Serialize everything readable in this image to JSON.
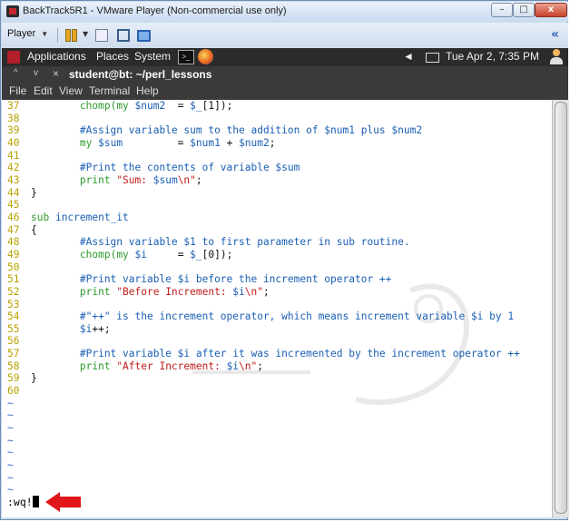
{
  "window": {
    "title": "BackTrack5R1 - VMware Player (Non-commercial use only)",
    "min": "–",
    "max": "□",
    "close": "x"
  },
  "vm_toolbar": {
    "player_label": "Player",
    "caret": "▼",
    "collapse": "«"
  },
  "gnome_panel": {
    "applications": "Applications",
    "places": "Places",
    "system": "System",
    "terminal_icon": ">_",
    "clock": "Tue Apr  2,  7:35 PM"
  },
  "terminal": {
    "title": "student@bt: ~/perl_lessons",
    "up": "^",
    "down": "v",
    "close": "×",
    "menu": [
      "File",
      "Edit",
      "View",
      "Terminal",
      "Help"
    ]
  },
  "editor": {
    "lines": [
      {
        "n": "37",
        "segs": [
          [
            "plain",
            "        "
          ],
          [
            "kw",
            "chomp("
          ],
          [
            "kw",
            "my "
          ],
          [
            "var",
            "$num2"
          ],
          [
            "plain",
            "  = "
          ],
          [
            "var",
            "$_"
          ],
          [
            "plain",
            "[1]);"
          ]
        ]
      },
      {
        "n": "38",
        "segs": []
      },
      {
        "n": "39",
        "segs": [
          [
            "cmt",
            "        #Assign variable sum to the addition of $num1 plus $num2"
          ]
        ]
      },
      {
        "n": "40",
        "segs": [
          [
            "plain",
            "        "
          ],
          [
            "kw",
            "my "
          ],
          [
            "var",
            "$sum"
          ],
          [
            "plain",
            "         = "
          ],
          [
            "var",
            "$num1"
          ],
          [
            "plain",
            " + "
          ],
          [
            "var",
            "$num2"
          ],
          [
            "plain",
            ";"
          ]
        ]
      },
      {
        "n": "41",
        "segs": []
      },
      {
        "n": "42",
        "segs": [
          [
            "cmt",
            "        #Print the contents of variable $sum"
          ]
        ]
      },
      {
        "n": "43",
        "segs": [
          [
            "plain",
            "        "
          ],
          [
            "kw",
            "print "
          ],
          [
            "str",
            "\"Sum: "
          ],
          [
            "var",
            "$sum"
          ],
          [
            "str",
            "\\n\""
          ],
          [
            "plain",
            ";"
          ]
        ]
      },
      {
        "n": "44",
        "segs": [
          [
            "plain",
            "}"
          ]
        ]
      },
      {
        "n": "45",
        "segs": []
      },
      {
        "n": "46",
        "segs": [
          [
            "kw",
            "sub "
          ],
          [
            "var",
            "increment_it"
          ]
        ]
      },
      {
        "n": "47",
        "segs": [
          [
            "plain",
            "{"
          ]
        ]
      },
      {
        "n": "48",
        "segs": [
          [
            "cmt",
            "        #Assign variable $1 to first parameter in sub routine."
          ]
        ]
      },
      {
        "n": "49",
        "segs": [
          [
            "plain",
            "        "
          ],
          [
            "kw",
            "chomp("
          ],
          [
            "kw",
            "my "
          ],
          [
            "var",
            "$i"
          ],
          [
            "plain",
            "     = "
          ],
          [
            "var",
            "$_"
          ],
          [
            "plain",
            "[0]);"
          ]
        ]
      },
      {
        "n": "50",
        "segs": []
      },
      {
        "n": "51",
        "segs": [
          [
            "cmt",
            "        #Print variable $i before the increment operator ++"
          ]
        ]
      },
      {
        "n": "52",
        "segs": [
          [
            "plain",
            "        "
          ],
          [
            "kw",
            "print "
          ],
          [
            "str",
            "\"Before Increment: "
          ],
          [
            "var",
            "$i"
          ],
          [
            "str",
            "\\n\""
          ],
          [
            "plain",
            ";"
          ]
        ]
      },
      {
        "n": "53",
        "segs": []
      },
      {
        "n": "54",
        "segs": [
          [
            "cmt",
            "        #\"++\" is the increment operator, which means increment variable $i by 1"
          ]
        ]
      },
      {
        "n": "55",
        "segs": [
          [
            "plain",
            "        "
          ],
          [
            "var",
            "$i"
          ],
          [
            "plain",
            "++;"
          ]
        ]
      },
      {
        "n": "56",
        "segs": []
      },
      {
        "n": "57",
        "segs": [
          [
            "cmt",
            "        #Print variable $i after it was incremented by the increment operator ++"
          ]
        ]
      },
      {
        "n": "58",
        "segs": [
          [
            "plain",
            "        "
          ],
          [
            "kw",
            "print "
          ],
          [
            "str",
            "\"After Increment: "
          ],
          [
            "var",
            "$i"
          ],
          [
            "str",
            "\\n\""
          ],
          [
            "plain",
            ";"
          ]
        ]
      },
      {
        "n": "59",
        "segs": [
          [
            "plain",
            "}"
          ]
        ]
      },
      {
        "n": "60",
        "segs": []
      }
    ],
    "tildes": [
      "~",
      "~",
      "~",
      "~",
      "~",
      "~",
      "~",
      "~"
    ],
    "command": ":wq!"
  }
}
